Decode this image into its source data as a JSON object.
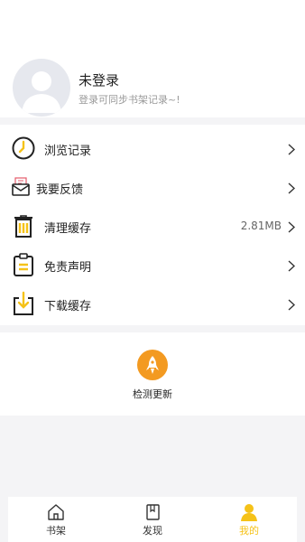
{
  "profile": {
    "name": "未登录",
    "hint": "登录可同步书架记录~!"
  },
  "menu": {
    "items": [
      {
        "label": "浏览记录",
        "icon": "clock-icon"
      },
      {
        "label": "我要反馈",
        "icon": "feedback-envelope-icon"
      },
      {
        "label": "清理缓存",
        "icon": "trash-icon",
        "value": "2.81MB"
      },
      {
        "label": "免责声明",
        "icon": "clipboard-icon"
      },
      {
        "label": "下载缓存",
        "icon": "download-icon"
      }
    ]
  },
  "update": {
    "label": "检测更新",
    "icon": "rocket-icon"
  },
  "tabs": [
    {
      "label": "书架",
      "icon": "home-icon"
    },
    {
      "label": "发现",
      "icon": "book-icon"
    },
    {
      "label": "我的",
      "icon": "user-icon",
      "active": true
    }
  ],
  "colors": {
    "accent": "#f5c218",
    "update_button": "#f39a21",
    "background": "#f4f4f6"
  }
}
